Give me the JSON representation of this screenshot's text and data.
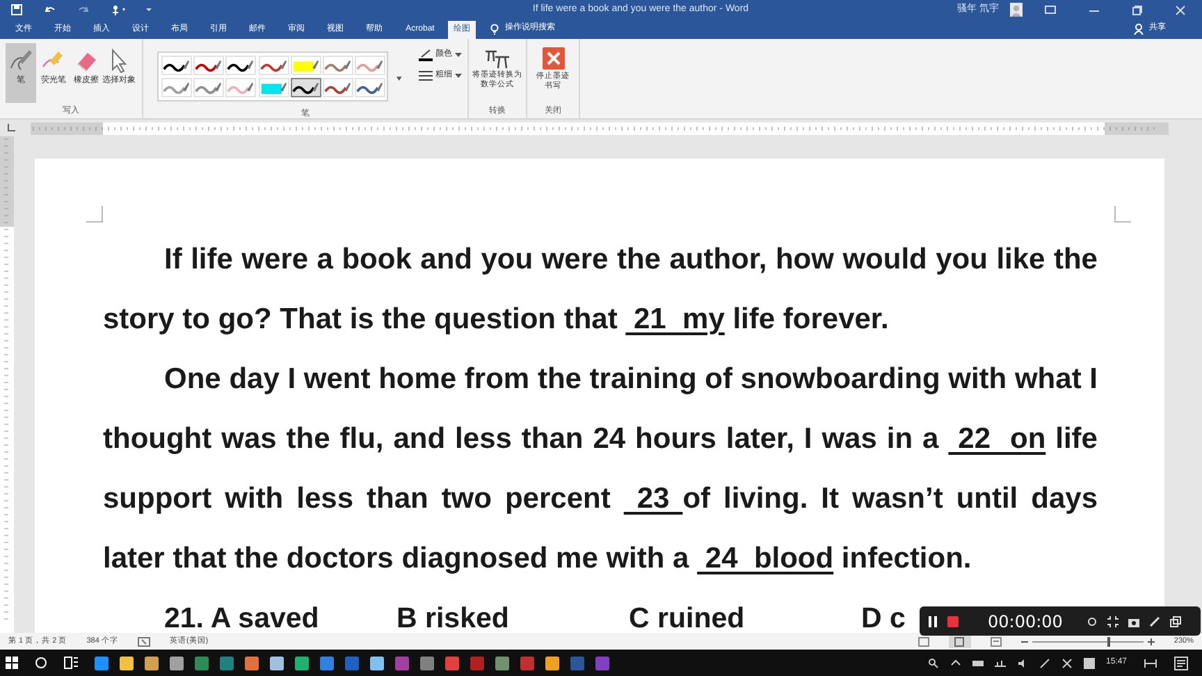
{
  "window": {
    "title": "If life were a book and you were the author - Word",
    "user": "骚年 氘宇"
  },
  "tabs": [
    {
      "label": "文件",
      "selected": false
    },
    {
      "label": "开始",
      "selected": false
    },
    {
      "label": "插入",
      "selected": false
    },
    {
      "label": "设计",
      "selected": false
    },
    {
      "label": "布局",
      "selected": false
    },
    {
      "label": "引用",
      "selected": false
    },
    {
      "label": "邮件",
      "selected": false
    },
    {
      "label": "审阅",
      "selected": false
    },
    {
      "label": "视图",
      "selected": false
    },
    {
      "label": "帮助",
      "selected": false
    },
    {
      "label": "Acrobat",
      "selected": false
    },
    {
      "label": "绘图",
      "selected": true
    }
  ],
  "search": {
    "placeholder": "操作说明搜索"
  },
  "share": "共享",
  "ribbon": {
    "write_tools": [
      {
        "label": "笔",
        "kind": "pen",
        "selected": true
      },
      {
        "label": "荧光笔",
        "kind": "highlighter",
        "selected": false
      },
      {
        "label": "橡皮擦",
        "kind": "eraser",
        "selected": false
      },
      {
        "label": "选择对象",
        "kind": "select",
        "selected": false
      }
    ],
    "write_label": "写入",
    "pens": [
      {
        "kind": "pen",
        "color": "#000000",
        "selected": false
      },
      {
        "kind": "pen",
        "color": "#c00000",
        "selected": false
      },
      {
        "kind": "pen",
        "color": "#000000",
        "selected": false
      },
      {
        "kind": "pen",
        "color": "#c0392b",
        "selected": false
      },
      {
        "kind": "highlighter",
        "color": "#ffff00",
        "selected": false
      },
      {
        "kind": "pen",
        "color": "#a08070",
        "selected": false
      },
      {
        "kind": "pen",
        "color": "#e0a0a0",
        "selected": false
      },
      {
        "kind": "pen",
        "color": "#a0a0a0",
        "selected": false
      },
      {
        "kind": "pen",
        "color": "#909090",
        "selected": false
      },
      {
        "kind": "pen",
        "color": "#f0b0b0",
        "selected": false
      },
      {
        "kind": "highlighter",
        "color": "#00e5ee",
        "selected": false
      },
      {
        "kind": "pen",
        "color": "#000000",
        "selected": true
      },
      {
        "kind": "pen",
        "color": "#b04030",
        "selected": false
      },
      {
        "kind": "pen",
        "color": "#4060a0",
        "selected": false
      }
    ],
    "pen_options": [
      "颜色",
      "粗细"
    ],
    "pens_label": "笔",
    "convert": {
      "button": "将墨迹转换为数学公式",
      "label": "转换"
    },
    "close": {
      "button": "停止墨迹书写",
      "label": "关闭"
    }
  },
  "document": {
    "paragraphs": [
      {
        "segments": [
          {
            "text": "If life were a book and you were the author, how would you like the story to go? That is the question that ",
            "kind": "text"
          },
          {
            "text": " 21  my",
            "kind": "blank"
          },
          {
            "text": " life forever.",
            "kind": "text"
          }
        ]
      },
      {
        "segments": [
          {
            "text": "One day I went home from the training of snowboarding with what I thought was the flu, and less than 24 hours later, I was in a ",
            "kind": "text"
          },
          {
            "text": " 22  on",
            "kind": "blank"
          },
          {
            "text": " life support with less than two percent ",
            "kind": "text"
          },
          {
            "text": " 23 ",
            "kind": "blank"
          },
          {
            "text": "of living. It wasn’t until days later that the doctors diagnosed me with a ",
            "kind": "text"
          },
          {
            "text": " 24  blood",
            "kind": "blank"
          },
          {
            "text": " infection.",
            "kind": "text"
          }
        ]
      }
    ],
    "options": [
      "21. A saved",
      "B risked",
      "C ruined",
      "D c"
    ]
  },
  "status_bar": {
    "page": "第 1 页，共 2 页",
    "words": "384 个字",
    "language": "英语(美国)",
    "zoom": "230%",
    "zoom_slider": {
      "level": 0.68
    }
  },
  "recorder": {
    "time": "00:00:00"
  },
  "taskbar": {
    "time": "15:47"
  }
}
